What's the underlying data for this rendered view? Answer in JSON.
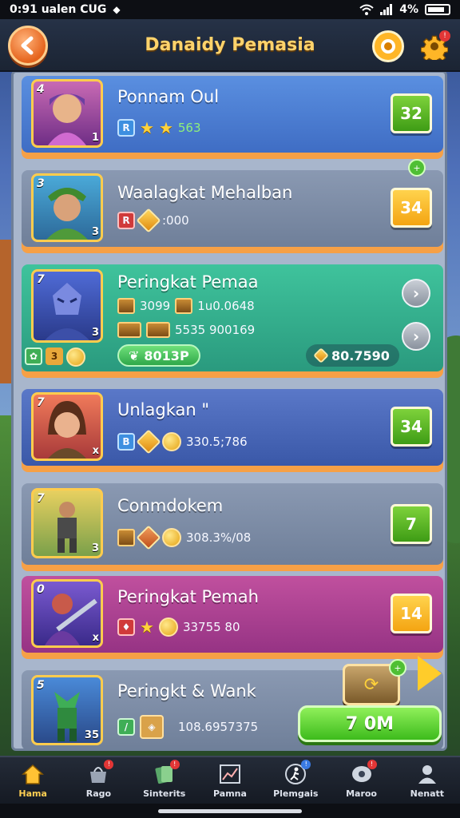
{
  "statusbar": {
    "left_text": "0:91 ualen CUG",
    "battery": "4%"
  },
  "header": {
    "title": "Danaidy Pemasia"
  },
  "rows": [
    {
      "rank": "4",
      "level": "1",
      "name": "Ponnam Oul",
      "chip": "R",
      "stat": "563",
      "score": "32",
      "bg": "#4a7fd4"
    },
    {
      "rank": "3",
      "level": "3",
      "name": "Waalagkat Mehalban",
      "chip": "R",
      "stat": ":000",
      "score": "34",
      "bg": "#7f8ea6"
    },
    {
      "rank": "7",
      "level": "3",
      "name": "Peringkat Pemaa",
      "stat_a": "3099",
      "stat_b": "1u0.0648",
      "stat_c": "5535 900169",
      "pill_left": "8013P",
      "pill_right": "80.7590",
      "tag_a": "3",
      "bg": "#35b08f"
    },
    {
      "rank": "7",
      "level": "x",
      "name": "Unlagkan \"",
      "chip": "B",
      "stat": "330.5;786",
      "score": "34",
      "bg": "#4a6ab8"
    },
    {
      "rank": "7",
      "level": "3",
      "name": "Conmdokem",
      "stat": "308.3%/08",
      "score": "7",
      "bg": "#7f8ea6"
    },
    {
      "rank": "0",
      "level": "x",
      "name": "Peringkat Pemah",
      "stat": "33755 80",
      "score": "14",
      "bg": "#b0439c"
    },
    {
      "rank": "5",
      "level": "35",
      "name": "Peringkt & Wank",
      "stat": "108.6957375",
      "cta": "7 0M",
      "bg": "#7f8ea6"
    }
  ],
  "nav": [
    {
      "label": "Hama",
      "active": true
    },
    {
      "label": "Rago"
    },
    {
      "label": "Sinterits"
    },
    {
      "label": "Pamna"
    },
    {
      "label": "Plemgais"
    },
    {
      "label": "Maroo"
    },
    {
      "label": "Nenatt"
    }
  ],
  "colors": {
    "accent": "#ffd36b",
    "row_shadow": "#f6a046",
    "score_green": "#4fb02a",
    "score_yellow": "#f9b930"
  },
  "icons": [
    "back-arrow-icon",
    "target-icon",
    "gear-icon",
    "star-icon",
    "coin-icon",
    "gem-icon",
    "crate-icon",
    "chevron-right-icon",
    "chest-icon",
    "play-icon",
    "home-icon",
    "shop-icon",
    "cards-icon",
    "chart-icon",
    "runner-icon",
    "chat-icon",
    "profile-icon"
  ]
}
